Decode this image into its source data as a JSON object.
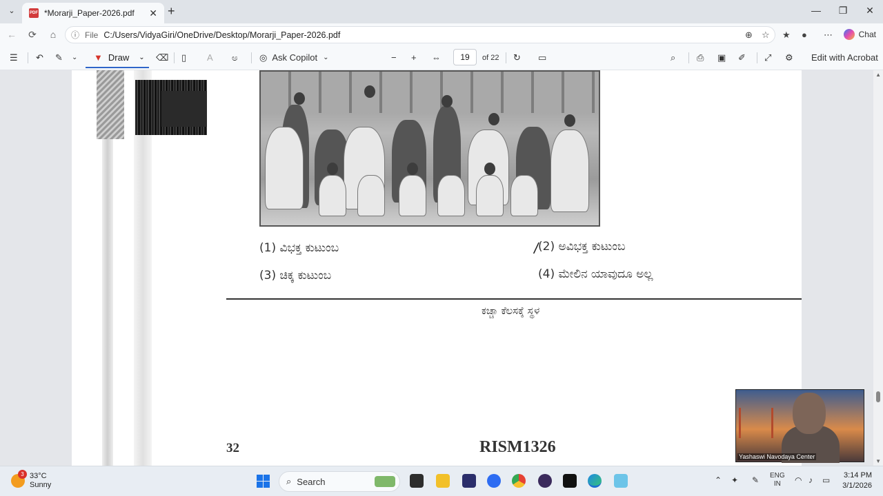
{
  "browser": {
    "tab_title": "*Morarji_Paper-2026.pdf",
    "tab_icon": "PDF",
    "url_label": "File",
    "url": "C:/Users/VidyaGiri/OneDrive/Desktop/Morarji_Paper-2026.pdf",
    "chat_label": "Chat"
  },
  "toolbar": {
    "draw_label": "Draw",
    "ask_copilot_label": "Ask Copilot",
    "page_current": "19",
    "page_total": "of 22",
    "edit_acrobat_label": "Edit with Acrobat"
  },
  "document": {
    "options": [
      {
        "num": "(1)",
        "text": "ವಿಭಕ್ತ ಕುಟುಂಬ"
      },
      {
        "num": "(2)",
        "text": "ಅವಿಭಕ್ತ ಕುಟುಂಬ"
      },
      {
        "num": "(3)",
        "text": "ಚಿಕ್ಕ ಕುಟುಂಬ"
      },
      {
        "num": "(4)",
        "text": "ಮೇಲಿನ ಯಾವುದೂ ಅಲ್ಲ"
      }
    ],
    "rough_work_label": "ಕಚ್ಚಾ ಕೆಲಸಕ್ಕೆ ಸ್ಥಳ",
    "page_number": "32",
    "paper_code": "RISM1326"
  },
  "video_overlay": {
    "name": "Yashaswi Navodaya Center"
  },
  "taskbar": {
    "temperature": "33°C",
    "weather": "Sunny",
    "weather_badge": "3",
    "search_label": "Search",
    "lang_line1": "ENG",
    "lang_line2": "IN",
    "time": "3:14 PM",
    "date": "3/1/2026"
  }
}
